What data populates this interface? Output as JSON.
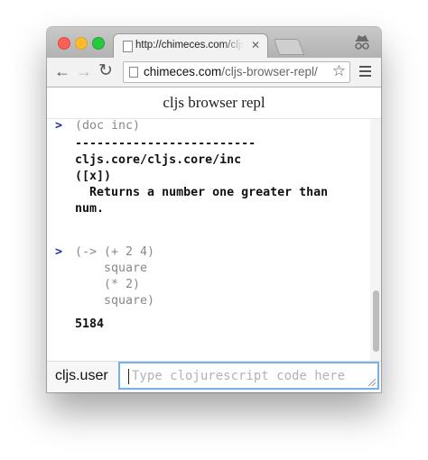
{
  "browser": {
    "tab_title": "http://chimeces.com/cljs-b",
    "tab_close": "✕",
    "url_host": "chimeces.com",
    "url_path": "/cljs-browser-repl/",
    "nav": {
      "back": "←",
      "forward": "→",
      "reload": "↻"
    },
    "star": "☆"
  },
  "app": {
    "title": "cljs browser repl",
    "prompt_symbol": ">",
    "entries": [
      {
        "input_lines": [
          "(doc inc)"
        ],
        "output_lines": [
          "-------------------------",
          "cljs.core/cljs.core/inc",
          "([x])",
          "  Returns a number one greater than",
          "num."
        ]
      },
      {
        "input_lines": [
          "(-> (+ 2 4)",
          "    square",
          "    (* 2)",
          "    square)"
        ],
        "output_lines": [
          "5184"
        ]
      }
    ],
    "namespace": "cljs.user",
    "input_placeholder": "Type clojurescript code here"
  },
  "colors": {
    "prompt": "#1e2fa0",
    "input_focus": "#7ab0e8",
    "close": "#fc5f57",
    "minimize": "#fdbb2e",
    "maximize": "#2ac840"
  },
  "icons": [
    "close-window-icon",
    "minimize-window-icon",
    "maximize-window-icon",
    "page-icon",
    "incognito-icon",
    "back-arrow-icon",
    "forward-arrow-icon",
    "reload-icon",
    "bookmark-star-icon",
    "menu-icon"
  ]
}
